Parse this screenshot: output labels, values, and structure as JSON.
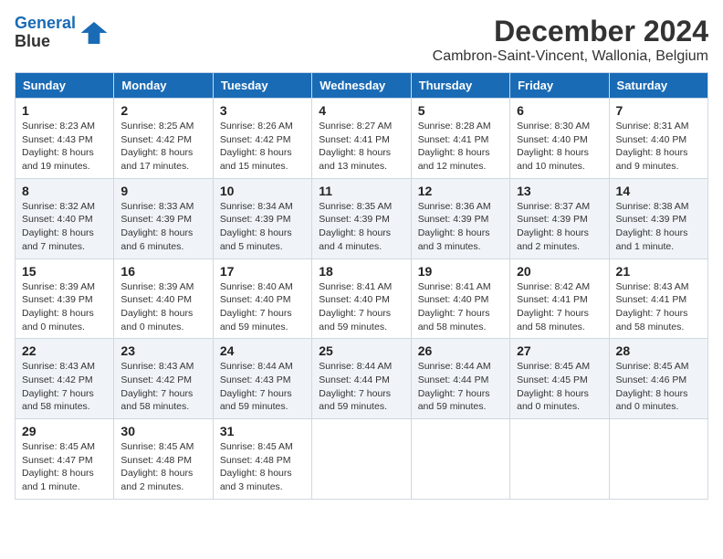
{
  "logo": {
    "line1": "General",
    "line2": "Blue"
  },
  "title": "December 2024",
  "subtitle": "Cambron-Saint-Vincent, Wallonia, Belgium",
  "days_of_week": [
    "Sunday",
    "Monday",
    "Tuesday",
    "Wednesday",
    "Thursday",
    "Friday",
    "Saturday"
  ],
  "weeks": [
    [
      {
        "day": 1,
        "sunrise": "8:23 AM",
        "sunset": "4:43 PM",
        "daylight": "8 hours and 19 minutes"
      },
      {
        "day": 2,
        "sunrise": "8:25 AM",
        "sunset": "4:42 PM",
        "daylight": "8 hours and 17 minutes"
      },
      {
        "day": 3,
        "sunrise": "8:26 AM",
        "sunset": "4:42 PM",
        "daylight": "8 hours and 15 minutes"
      },
      {
        "day": 4,
        "sunrise": "8:27 AM",
        "sunset": "4:41 PM",
        "daylight": "8 hours and 13 minutes"
      },
      {
        "day": 5,
        "sunrise": "8:28 AM",
        "sunset": "4:41 PM",
        "daylight": "8 hours and 12 minutes"
      },
      {
        "day": 6,
        "sunrise": "8:30 AM",
        "sunset": "4:40 PM",
        "daylight": "8 hours and 10 minutes"
      },
      {
        "day": 7,
        "sunrise": "8:31 AM",
        "sunset": "4:40 PM",
        "daylight": "8 hours and 9 minutes"
      }
    ],
    [
      {
        "day": 8,
        "sunrise": "8:32 AM",
        "sunset": "4:40 PM",
        "daylight": "8 hours and 7 minutes"
      },
      {
        "day": 9,
        "sunrise": "8:33 AM",
        "sunset": "4:39 PM",
        "daylight": "8 hours and 6 minutes"
      },
      {
        "day": 10,
        "sunrise": "8:34 AM",
        "sunset": "4:39 PM",
        "daylight": "8 hours and 5 minutes"
      },
      {
        "day": 11,
        "sunrise": "8:35 AM",
        "sunset": "4:39 PM",
        "daylight": "8 hours and 4 minutes"
      },
      {
        "day": 12,
        "sunrise": "8:36 AM",
        "sunset": "4:39 PM",
        "daylight": "8 hours and 3 minutes"
      },
      {
        "day": 13,
        "sunrise": "8:37 AM",
        "sunset": "4:39 PM",
        "daylight": "8 hours and 2 minutes"
      },
      {
        "day": 14,
        "sunrise": "8:38 AM",
        "sunset": "4:39 PM",
        "daylight": "8 hours and 1 minute"
      }
    ],
    [
      {
        "day": 15,
        "sunrise": "8:39 AM",
        "sunset": "4:39 PM",
        "daylight": "8 hours and 0 minutes"
      },
      {
        "day": 16,
        "sunrise": "8:39 AM",
        "sunset": "4:40 PM",
        "daylight": "8 hours and 0 minutes"
      },
      {
        "day": 17,
        "sunrise": "8:40 AM",
        "sunset": "4:40 PM",
        "daylight": "7 hours and 59 minutes"
      },
      {
        "day": 18,
        "sunrise": "8:41 AM",
        "sunset": "4:40 PM",
        "daylight": "7 hours and 59 minutes"
      },
      {
        "day": 19,
        "sunrise": "8:41 AM",
        "sunset": "4:40 PM",
        "daylight": "7 hours and 58 minutes"
      },
      {
        "day": 20,
        "sunrise": "8:42 AM",
        "sunset": "4:41 PM",
        "daylight": "7 hours and 58 minutes"
      },
      {
        "day": 21,
        "sunrise": "8:43 AM",
        "sunset": "4:41 PM",
        "daylight": "7 hours and 58 minutes"
      }
    ],
    [
      {
        "day": 22,
        "sunrise": "8:43 AM",
        "sunset": "4:42 PM",
        "daylight": "7 hours and 58 minutes"
      },
      {
        "day": 23,
        "sunrise": "8:43 AM",
        "sunset": "4:42 PM",
        "daylight": "7 hours and 58 minutes"
      },
      {
        "day": 24,
        "sunrise": "8:44 AM",
        "sunset": "4:43 PM",
        "daylight": "7 hours and 59 minutes"
      },
      {
        "day": 25,
        "sunrise": "8:44 AM",
        "sunset": "4:44 PM",
        "daylight": "7 hours and 59 minutes"
      },
      {
        "day": 26,
        "sunrise": "8:44 AM",
        "sunset": "4:44 PM",
        "daylight": "7 hours and 59 minutes"
      },
      {
        "day": 27,
        "sunrise": "8:45 AM",
        "sunset": "4:45 PM",
        "daylight": "8 hours and 0 minutes"
      },
      {
        "day": 28,
        "sunrise": "8:45 AM",
        "sunset": "4:46 PM",
        "daylight": "8 hours and 0 minutes"
      }
    ],
    [
      {
        "day": 29,
        "sunrise": "8:45 AM",
        "sunset": "4:47 PM",
        "daylight": "8 hours and 1 minute"
      },
      {
        "day": 30,
        "sunrise": "8:45 AM",
        "sunset": "4:48 PM",
        "daylight": "8 hours and 2 minutes"
      },
      {
        "day": 31,
        "sunrise": "8:45 AM",
        "sunset": "4:48 PM",
        "daylight": "8 hours and 3 minutes"
      },
      null,
      null,
      null,
      null
    ]
  ]
}
